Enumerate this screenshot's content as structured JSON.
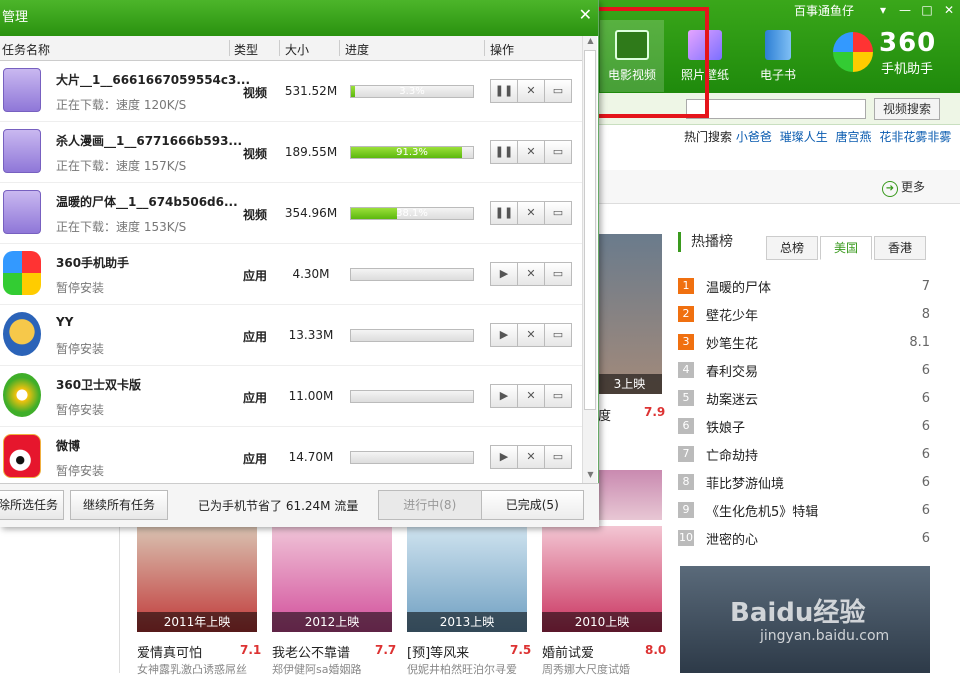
{
  "topbar": {
    "account": "百事通鱼仔",
    "win_buttons": [
      "▾",
      "—",
      "□",
      "✕"
    ]
  },
  "nav_tabs": [
    {
      "label": "电影视频",
      "icon": "film-icon",
      "active": true
    },
    {
      "label": "照片壁纸",
      "icon": "photo-icon",
      "active": false
    },
    {
      "label": "电子书",
      "icon": "ebook-icon",
      "active": false
    }
  ],
  "logo": {
    "big": "360",
    "small": "手机助手"
  },
  "search": {
    "button": "视频搜索",
    "placeholder": ""
  },
  "hot": {
    "label": "热门搜索",
    "items": [
      "小爸爸",
      "璀璨人生",
      "唐宫燕",
      "花非花雾非雾"
    ]
  },
  "more_label": "更多",
  "ranking": {
    "title": "热播榜",
    "tabs": [
      "总榜",
      "美国",
      "香港"
    ],
    "active_tab": 1,
    "items": [
      {
        "n": "1",
        "name": "温暖的尸体",
        "score": "7"
      },
      {
        "n": "2",
        "name": "壁花少年",
        "score": "8"
      },
      {
        "n": "3",
        "name": "妙笔生花",
        "score": "8.1"
      },
      {
        "n": "4",
        "name": "春利交易",
        "score": "6"
      },
      {
        "n": "5",
        "name": "劫案迷云",
        "score": "6"
      },
      {
        "n": "6",
        "name": "铁娘子",
        "score": "6"
      },
      {
        "n": "7",
        "name": "亡命劫持",
        "score": "6"
      },
      {
        "n": "8",
        "name": "菲比梦游仙境",
        "score": "6"
      },
      {
        "n": "9",
        "name": "《生化危机5》特辑",
        "score": "6"
      },
      {
        "n": "10",
        "name": "泄密的心",
        "score": "6"
      }
    ]
  },
  "poster_top": {
    "caption": "3上映",
    "frag": "度",
    "score": "7.9"
  },
  "posters": [
    {
      "caption": "2011年上映",
      "title": "爱情真可怕",
      "score": "7.1",
      "desc": "女神露乳激凸诱惑屌丝"
    },
    {
      "caption": "2012上映",
      "title": "我老公不靠谱",
      "score": "7.7",
      "desc": "郑伊健阿sa婚姻路"
    },
    {
      "caption": "2013上映",
      "title": "[预]等风来",
      "score": "7.5",
      "desc": "倪妮井柏然旺泊尔寻爱"
    },
    {
      "caption": "2010上映",
      "title": "婚前试爱",
      "score": "8.0",
      "desc": "周秀娜大尺度试婚"
    }
  ],
  "watermark": {
    "a": "Baidu经验",
    "b": "jingyan.baidu.com"
  },
  "dialog": {
    "title": "管理",
    "close": "✕",
    "columns": [
      "任务名称",
      "类型",
      "大小",
      "进度",
      "操作"
    ],
    "tasks": [
      {
        "name": "大片__1__6661667059554c3...",
        "status": "正在下载：速度 120K/S",
        "type": "视频",
        "size": "531.52M",
        "progress": 0.033,
        "ptext": "3.3%",
        "icon": "video-file-icon",
        "kind": "video"
      },
      {
        "name": "杀人漫画__1__6771666b593...",
        "status": "正在下载：速度 157K/S",
        "type": "视频",
        "size": "189.55M",
        "progress": 0.913,
        "ptext": "91.3%",
        "icon": "video-file-icon",
        "kind": "video"
      },
      {
        "name": "温暖的尸体__1__674b506d6...",
        "status": "正在下载：速度 153K/S",
        "type": "视频",
        "size": "354.96M",
        "progress": 0.381,
        "ptext": "38.1%",
        "icon": "video-file-icon",
        "kind": "video"
      },
      {
        "name": "360手机助手",
        "status": "暂停安装",
        "type": "应用",
        "size": "4.30M",
        "progress": 0,
        "ptext": "",
        "icon": "app-360-assistant-icon",
        "kind": "app"
      },
      {
        "name": "YY",
        "status": "暂停安装",
        "type": "应用",
        "size": "13.33M",
        "progress": 0,
        "ptext": "",
        "icon": "app-yy-icon",
        "kind": "app"
      },
      {
        "name": "360卫士双卡版",
        "status": "暂停安装",
        "type": "应用",
        "size": "11.00M",
        "progress": 0,
        "ptext": "",
        "icon": "app-360-guard-icon",
        "kind": "app"
      },
      {
        "name": "微博",
        "status": "暂停安装",
        "type": "应用",
        "size": "14.70M",
        "progress": 0,
        "ptext": "",
        "icon": "app-weibo-icon",
        "kind": "app"
      }
    ],
    "footer": {
      "delete": "除所选任务",
      "resume": "继续所有任务",
      "saved": "已为手机节省了 61.24M 流量",
      "tab_running": "进行中(8)",
      "tab_done": "已完成(5)"
    }
  },
  "colors": {
    "green": "#2a920f",
    "accent": "#3a9a1e",
    "red_box": "#e5141b",
    "hot_rank": "#f07010"
  }
}
